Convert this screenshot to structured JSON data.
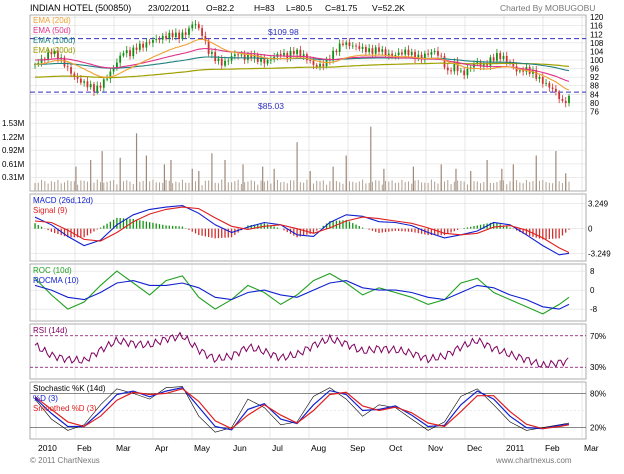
{
  "header": {
    "title": "INDIAN HOTEL (500850)",
    "date": "23/02/2011",
    "open": "O=82.2",
    "high": "H=83",
    "low": "L=80.5",
    "close": "C=81.75",
    "volume": "V=52.2K",
    "credit": "Charted By MOBUGOBU",
    "footer_left": "© 2011 ChartNexus",
    "footer_right": "www.chartnexus.com"
  },
  "colors": {
    "ema20": "#f0a030",
    "ema50": "#e0308a",
    "ema100": "#208080",
    "ema200": "#a0a000",
    "bull": "#109010",
    "bear": "#d03030",
    "blue_line": "#1020d0",
    "red_line": "#e02020",
    "green_line": "#20a020",
    "purple_line": "#800060",
    "reference": "#3030c0",
    "grid": "#d8d8d8"
  },
  "chart_data": [
    {
      "panel": "price",
      "type": "candlestick",
      "legend": [
        "EMA (20d)",
        "EMA (50d)",
        "EMA (100d)",
        "EMA (200d)"
      ],
      "x_labels": [
        "2010",
        "Feb",
        "Mar",
        "Apr",
        "May",
        "Jun",
        "Jul",
        "Aug",
        "Sep",
        "Oct",
        "Nov",
        "Dec",
        "2011",
        "Feb",
        "Mar"
      ],
      "y_ticks": [
        76,
        80,
        84,
        88,
        92,
        96,
        100,
        104,
        108,
        112,
        116,
        120
      ],
      "ylim": [
        72,
        121
      ],
      "reference_lines": [
        {
          "label": "$109.98",
          "value": 109.98
        },
        {
          "label": "$85.03",
          "value": 85.03
        }
      ],
      "close_path_x": [
        0,
        6,
        10,
        15,
        19,
        24,
        28,
        33,
        37,
        41,
        45,
        50,
        54,
        58,
        62,
        67,
        71,
        76,
        80,
        84,
        88,
        93,
        97,
        102,
        106,
        111,
        115,
        119,
        123,
        128,
        132,
        137,
        141,
        145,
        149,
        154,
        158,
        162,
        167,
        171,
        176,
        180,
        184,
        188,
        192,
        197,
        201,
        205,
        210,
        214,
        218,
        222,
        227,
        231,
        235,
        240,
        244,
        248,
        252,
        256,
        261,
        265,
        269,
        274,
        278,
        282,
        286,
        291,
        295,
        299,
        304,
        308,
        313,
        317,
        322,
        326
      ],
      "close_path_y": [
        98,
        101,
        104,
        101,
        97,
        92,
        90,
        88,
        86,
        89,
        93,
        99,
        104,
        103,
        106,
        107,
        109,
        110,
        111,
        112,
        111,
        113,
        118,
        112,
        104,
        100,
        98,
        101,
        103,
        101,
        102,
        100,
        99,
        101,
        103,
        102,
        104,
        103,
        100,
        97,
        98,
        101,
        105,
        108,
        107,
        106,
        105,
        104,
        105,
        103,
        102,
        103,
        104,
        102,
        101,
        103,
        104,
        101,
        94,
        98,
        93,
        96,
        99,
        97,
        100,
        102,
        101,
        98,
        94,
        96,
        94,
        91,
        88,
        86,
        80,
        82
      ],
      "ema20_end": 86,
      "ema50_end": 90,
      "ema100_end": 95,
      "ema200_end": 97
    },
    {
      "panel": "volume",
      "type": "bar",
      "y_ticks_labels": [
        "1.53M",
        "1.22M",
        "0.92M",
        "0.61M",
        "0.31M"
      ],
      "y_ticks": [
        1.53,
        1.22,
        0.92,
        0.61,
        0.31
      ],
      "ylim": [
        0,
        1.6
      ],
      "spikes_x": [
        25,
        34,
        41,
        52,
        62,
        68,
        79,
        83,
        96,
        100,
        108,
        116,
        127,
        139,
        146,
        160,
        168,
        182,
        190,
        205,
        213,
        231,
        248,
        257,
        266,
        276,
        285,
        292,
        306,
        318,
        324
      ],
      "spikes_volume": [
        0.55,
        0.7,
        0.9,
        0.75,
        1.3,
        0.8,
        0.6,
        0.7,
        0.5,
        0.45,
        0.85,
        0.7,
        0.6,
        0.55,
        0.5,
        1.1,
        0.45,
        0.55,
        0.8,
        1.45,
        0.5,
        0.55,
        0.6,
        0.5,
        0.45,
        0.7,
        0.5,
        0.6,
        0.8,
        0.9,
        0.4
      ]
    },
    {
      "panel": "macd",
      "type": "line",
      "legend": [
        "MACD (26d,12d)",
        "Signal (9)"
      ],
      "y_tick_labels": [
        "3.249",
        "0",
        "-3.249"
      ],
      "y_ticks": [
        3.249,
        0,
        -3.249
      ],
      "ylim": [
        -4.2,
        4.5
      ],
      "x": [
        0,
        10,
        20,
        30,
        40,
        50,
        60,
        70,
        80,
        90,
        100,
        110,
        120,
        130,
        140,
        150,
        160,
        170,
        180,
        190,
        200,
        210,
        220,
        230,
        240,
        250,
        260,
        270,
        280,
        290,
        300,
        310,
        320,
        326
      ],
      "macd": [
        1.5,
        0.5,
        -1.0,
        -2.2,
        -1.5,
        0.5,
        1.8,
        2.5,
        2.8,
        3.0,
        2.0,
        0.5,
        -0.5,
        0.2,
        0.8,
        0.5,
        -0.8,
        -1.0,
        0.8,
        1.8,
        1.6,
        0.9,
        0.8,
        0.4,
        -0.5,
        -1.2,
        -0.8,
        -0.3,
        0.8,
        0.5,
        -0.8,
        -2.2,
        -3.4,
        -3.2
      ],
      "signal": [
        1.0,
        0.8,
        -0.2,
        -1.4,
        -1.6,
        -0.5,
        0.9,
        1.9,
        2.5,
        2.8,
        2.6,
        1.4,
        0.3,
        -0.1,
        0.3,
        0.5,
        0.0,
        -0.6,
        0.1,
        1.0,
        1.5,
        1.3,
        1.0,
        0.7,
        0.1,
        -0.6,
        -0.8,
        -0.6,
        0.2,
        0.4,
        -0.2,
        -1.2,
        -2.5,
        -3.1
      ]
    },
    {
      "panel": "roc",
      "type": "line",
      "legend": [
        "ROC (10d)",
        "ROCMA (10)"
      ],
      "y_tick_labels": [
        "8",
        "0",
        "-8"
      ],
      "y_ticks": [
        8,
        0,
        -8
      ],
      "ylim": [
        -13,
        11
      ],
      "x": [
        0,
        10,
        20,
        30,
        40,
        50,
        60,
        70,
        80,
        90,
        100,
        110,
        120,
        130,
        140,
        150,
        160,
        170,
        180,
        190,
        200,
        210,
        220,
        230,
        240,
        250,
        260,
        270,
        280,
        290,
        300,
        310,
        320,
        326
      ],
      "roc": [
        5,
        -2,
        -8,
        -5,
        2,
        8,
        3,
        -2,
        4,
        6,
        -3,
        -8,
        -4,
        2,
        -1,
        -6,
        -2,
        4,
        7,
        3,
        -2,
        1,
        -1,
        -3,
        -6,
        -4,
        3,
        5,
        -1,
        -4,
        -7,
        -10,
        -6,
        -3
      ],
      "rocma": [
        2,
        0,
        -3,
        -4,
        -1,
        3,
        4,
        2,
        2,
        3,
        1,
        -3,
        -4,
        -1,
        0,
        -2,
        -3,
        0,
        3,
        4,
        1,
        0,
        0,
        -1,
        -3,
        -4,
        -1,
        2,
        1,
        -2,
        -4,
        -7,
        -8,
        -6
      ]
    },
    {
      "panel": "rsi",
      "type": "line",
      "legend": [
        "RSI (14d)"
      ],
      "y_tick_labels": [
        "70%",
        "30%"
      ],
      "y_ticks": [
        70,
        30
      ],
      "ylim": [
        15,
        85
      ],
      "x": [
        0,
        10,
        20,
        30,
        40,
        50,
        60,
        70,
        80,
        90,
        100,
        110,
        120,
        130,
        140,
        150,
        160,
        170,
        180,
        190,
        200,
        210,
        220,
        230,
        240,
        250,
        260,
        270,
        280,
        290,
        300,
        310,
        320,
        326
      ],
      "rsi": [
        58,
        45,
        40,
        38,
        52,
        64,
        60,
        58,
        66,
        70,
        52,
        40,
        44,
        56,
        50,
        42,
        46,
        58,
        66,
        60,
        50,
        54,
        52,
        48,
        40,
        44,
        56,
        64,
        54,
        46,
        40,
        32,
        36,
        38
      ]
    },
    {
      "panel": "stochastic",
      "type": "line",
      "legend": [
        "Stochastic %K (14d)",
        "%D (3)",
        "Smoothed %D (3)"
      ],
      "y_tick_labels": [
        "80%",
        "20%"
      ],
      "y_ticks": [
        80,
        20
      ],
      "ylim": [
        0,
        100
      ],
      "x": [
        0,
        10,
        20,
        30,
        40,
        50,
        60,
        70,
        80,
        90,
        100,
        110,
        120,
        130,
        140,
        150,
        160,
        170,
        180,
        190,
        200,
        210,
        220,
        230,
        240,
        250,
        260,
        270,
        280,
        290,
        300,
        310,
        320,
        326
      ],
      "k": [
        70,
        35,
        15,
        25,
        60,
        88,
        80,
        70,
        90,
        92,
        40,
        12,
        20,
        70,
        55,
        25,
        30,
        75,
        90,
        70,
        40,
        60,
        55,
        35,
        15,
        30,
        75,
        88,
        60,
        30,
        15,
        20,
        25,
        28
      ],
      "d": [
        72,
        45,
        22,
        22,
        48,
        78,
        84,
        74,
        84,
        90,
        56,
        22,
        16,
        52,
        62,
        35,
        27,
        60,
        85,
        78,
        50,
        52,
        58,
        42,
        22,
        24,
        60,
        84,
        70,
        40,
        20,
        18,
        24,
        26
      ],
      "smoothed_d": [
        74,
        52,
        30,
        22,
        40,
        68,
        82,
        78,
        80,
        88,
        66,
        32,
        18,
        42,
        60,
        42,
        28,
        50,
        78,
        82,
        58,
        50,
        56,
        46,
        28,
        22,
        48,
        76,
        76,
        48,
        26,
        18,
        22,
        25
      ]
    }
  ]
}
